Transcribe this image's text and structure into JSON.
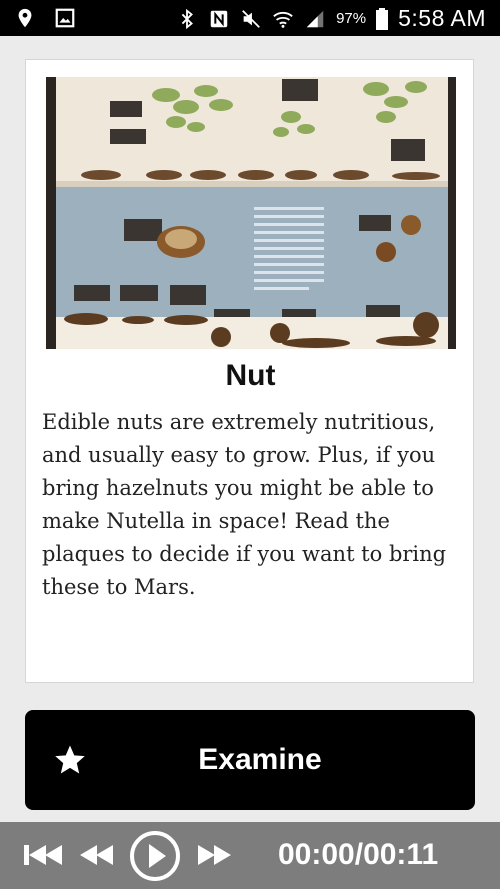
{
  "status_bar": {
    "battery": "97%",
    "time": "5:58 AM"
  },
  "card": {
    "title": "Nut",
    "description": "Edible nuts are extremely nutritious, and usually easy to grow. Plus, if you bring hazelnuts you might be able to make Nutella in space! Read the plaques to decide if you want to bring these to Mars."
  },
  "action": {
    "label": "Examine",
    "icon": "star-icon"
  },
  "player": {
    "time": "00:00/00:11",
    "controls": [
      "skip-back-icon",
      "rewind-icon",
      "play-icon",
      "fast-forward-icon"
    ]
  }
}
